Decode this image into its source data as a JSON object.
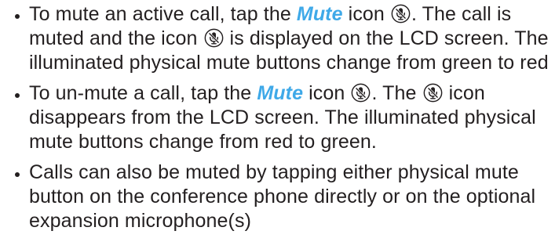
{
  "bullets": [
    {
      "parts": [
        {
          "type": "text",
          "value": "To mute an active call, tap the "
        },
        {
          "type": "keyword",
          "value": "Mute"
        },
        {
          "type": "text",
          "value": " icon "
        },
        {
          "type": "icon",
          "icon": "mute-microphone-icon"
        },
        {
          "type": "text",
          "value": ". The call is muted and the icon "
        },
        {
          "type": "icon",
          "icon": "mute-microphone-icon"
        },
        {
          "type": "text",
          "value": " is displayed on the LCD screen. The illuminated physical mute buttons change from green to red"
        }
      ]
    },
    {
      "parts": [
        {
          "type": "text",
          "value": "To un-mute a call, tap the "
        },
        {
          "type": "keyword",
          "value": "Mute"
        },
        {
          "type": "text",
          "value": " icon "
        },
        {
          "type": "icon",
          "icon": "mute-microphone-icon"
        },
        {
          "type": "text",
          "value": ". The "
        },
        {
          "type": "icon",
          "icon": "mute-microphone-icon"
        },
        {
          "type": "text",
          "value": " icon disappears from the LCD screen. The illuminated physical mute buttons change from red to green."
        }
      ]
    },
    {
      "parts": [
        {
          "type": "text",
          "value": "Calls can also be muted by tapping either physical mute button on the conference phone directly or on the optional expansion microphone(s)"
        }
      ]
    }
  ],
  "colors": {
    "text": "#231f20",
    "keyword": "#3fa9e8"
  }
}
